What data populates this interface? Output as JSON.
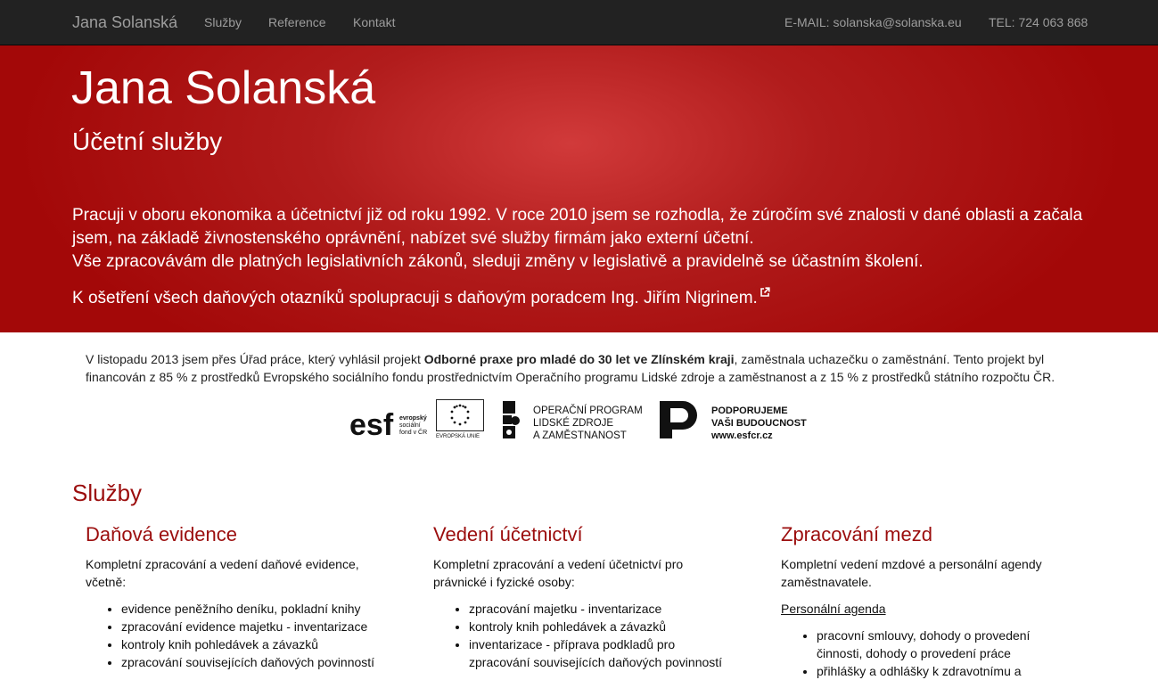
{
  "nav": {
    "brand": "Jana Solanská",
    "links": [
      "Služby",
      "Reference",
      "Kontakt"
    ],
    "email": "E-MAIL: solanska@solanska.eu",
    "phone": "TEL: 724 063 868"
  },
  "hero": {
    "title": "Jana Solanská",
    "subtitle": "Účetní služby",
    "paragraph1": "Pracuji v oboru ekonomika a účetnictví již od roku 1992. V roce 2010 jsem se rozhodla, že zúročím své znalosti v dané oblasti a začala jsem, na základě živnostenského oprávnění, nabízet své služby firmám jako externí účetní.",
    "paragraph1b": "Vše zpracovávám dle platných legislativních zákonů, sleduji změny v legislativě a pravidelně se účastním školení.",
    "paragraph2": "K ošetření všech daňových otazníků spolupracuji s daňovým poradcem Ing. Jiřím Nigrinem."
  },
  "notice": {
    "before": "V listopadu 2013 jsem přes Úřad práce, který vyhlásil projekt ",
    "bold": "Odborné praxe pro mladé do 30 let ve Zlínském kraji",
    "after": ", zaměstnala uchazečku o zaměstnání. Tento projekt byl financován z 85 % z prostředků Evropského sociálního fondu prostřednictvím Operačního programu Lidské zdroje a zaměstnanost a z 15 % z prostředků státního rozpočtu ČR."
  },
  "logos": {
    "esf_small": [
      "evropský",
      "sociální",
      "fond v ČR"
    ],
    "eu_label": "EVROPSKÁ UNIE",
    "op": [
      "OPERAČNÍ PROGRAM",
      "LIDSKÉ ZDROJE",
      "A ZAMĚSTNANOST"
    ],
    "support": [
      "PODPORUJEME",
      "VAŠI BUDOUCNOST",
      "www.esfcr.cz"
    ]
  },
  "services": {
    "title": "Služby",
    "columns": [
      {
        "heading": "Daňová evidence",
        "intro": "Kompletní zpracování a vedení daňové evidence, včetně:",
        "items": [
          "evidence peněžního deníku, pokladní knihy",
          "zpracování evidence majetku - inventarizace",
          "kontroly knih pohledávek a závazků",
          "zpracování souvisejících daňových povinností"
        ]
      },
      {
        "heading": "Vedení účetnictví",
        "intro": "Kompletní zpracování a vedení účetnictví pro právnické i fyzické osoby:",
        "items": [
          "zpracování majetku - inventarizace",
          "kontroly knih pohledávek a závazků",
          "inventarizace - příprava podkladů pro zpracování souvisejících daňových povinností"
        ]
      },
      {
        "heading": "Zpracování mezd",
        "intro": "Kompletní vedení mzdové a personální agendy zaměstnavatele.",
        "subheading": "Personální agenda",
        "items": [
          "pracovní smlouvy, dohody o provedení činnosti, dohody o provedení práce",
          "přihlášky a odhlášky k zdravotnímu a"
        ]
      }
    ]
  }
}
